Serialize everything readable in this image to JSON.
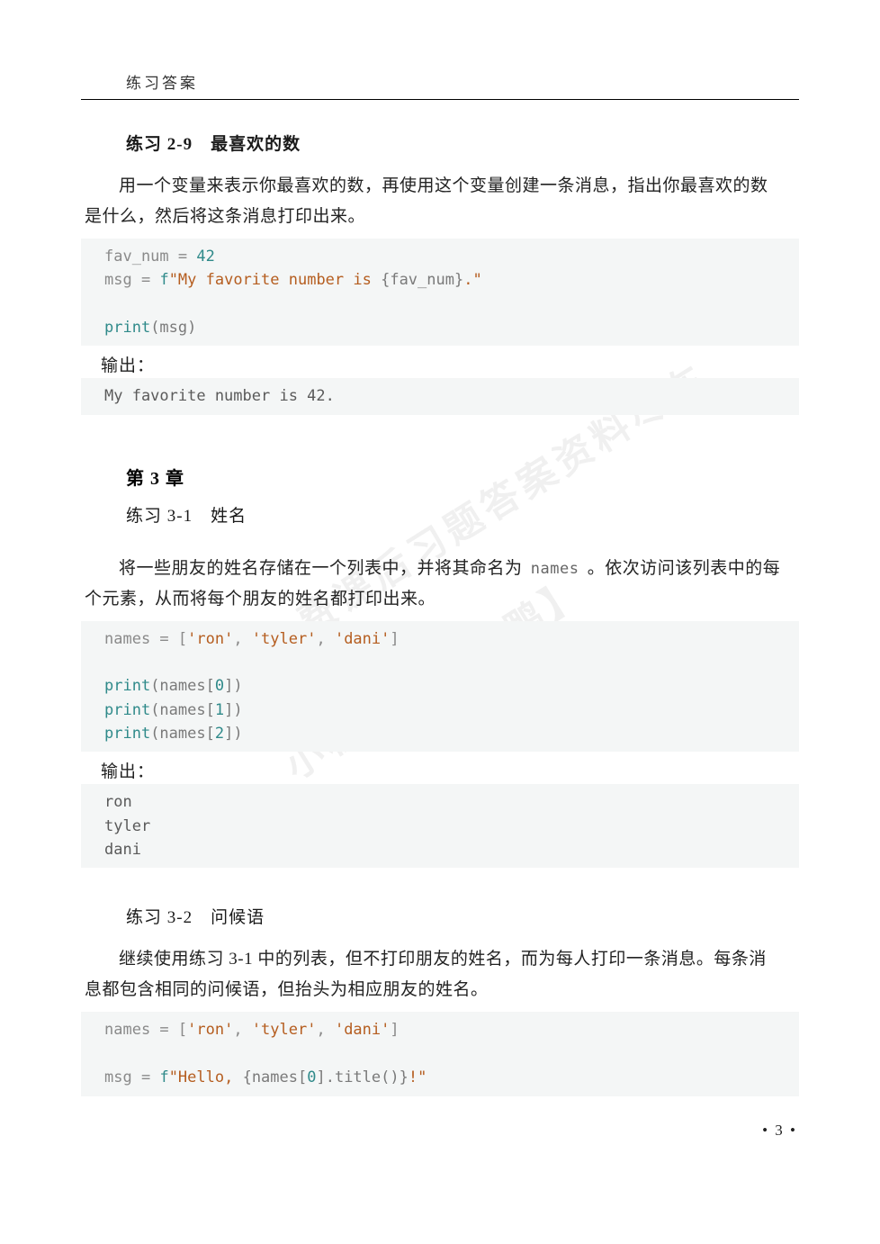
{
  "header": {
    "title": "练习答案"
  },
  "ex29": {
    "title": "练习 2-9　最喜欢的数",
    "desc_line1": "用一个变量来表示你最喜欢的数，再使用这个变量创建一条消息，指出你最喜欢的数",
    "desc_line2": "是什么，然后将这条消息打印出来。",
    "code": {
      "l1a": "fav_num ",
      "l1b": "= ",
      "l1c": "42",
      "l2a": "msg ",
      "l2b": "= ",
      "l2c": "f",
      "l2d": "\"My favorite number is ",
      "l2e": "{fav_num}",
      "l2f": ".\"",
      "l3a": "print",
      "l3b": "(msg)"
    },
    "output_label": "输出：",
    "output": "My favorite number is 42."
  },
  "chapter3": {
    "title": "第 3 章"
  },
  "ex31": {
    "title": "练习 3-1　姓名",
    "desc_p1a": "将一些朋友的姓名存储在一个列表中，并将其命名为 ",
    "desc_p1_code": "names",
    "desc_p1b": " 。依次访问该列表中的每",
    "desc_p2": "个元素，从而将每个朋友的姓名都打印出来。",
    "code": {
      "l1a": "names ",
      "l1b": "= [",
      "l1c": "'ron'",
      "l1d": ", ",
      "l1e": "'tyler'",
      "l1f": ", ",
      "l1g": "'dani'",
      "l1h": "]",
      "p1a": "print",
      "p1b": "(names[",
      "p1c": "0",
      "p1d": "])",
      "p2a": "print",
      "p2b": "(names[",
      "p2c": "1",
      "p2d": "])",
      "p3a": "print",
      "p3b": "(names[",
      "p3c": "2",
      "p3d": "])"
    },
    "output_label": "输出：",
    "output": "ron\ntyler\ndani"
  },
  "ex32": {
    "title": "练习 3-2　问候语",
    "desc_line1": "继续使用练习 3-1 中的列表，但不打印朋友的姓名，而为每人打印一条消息。每条消",
    "desc_line2": "息都包含相同的问候语，但抬头为相应朋友的姓名。",
    "code": {
      "l1a": "names ",
      "l1b": "= [",
      "l1c": "'ron'",
      "l1d": ", ",
      "l1e": "'tyler'",
      "l1f": ", ",
      "l1g": "'dani'",
      "l1h": "]",
      "l2a": "msg ",
      "l2b": "= ",
      "l2c": "f",
      "l2d": "\"Hello, ",
      "l2e": "{names[",
      "l2f": "0",
      "l2g": "].title()}",
      "l2h": "!\""
    }
  },
  "page_number": "• 3 •",
  "watermarks": {
    "w1": "更多免费课后习题答案资料尽在",
    "w2": "小程序【答案鸭】"
  }
}
